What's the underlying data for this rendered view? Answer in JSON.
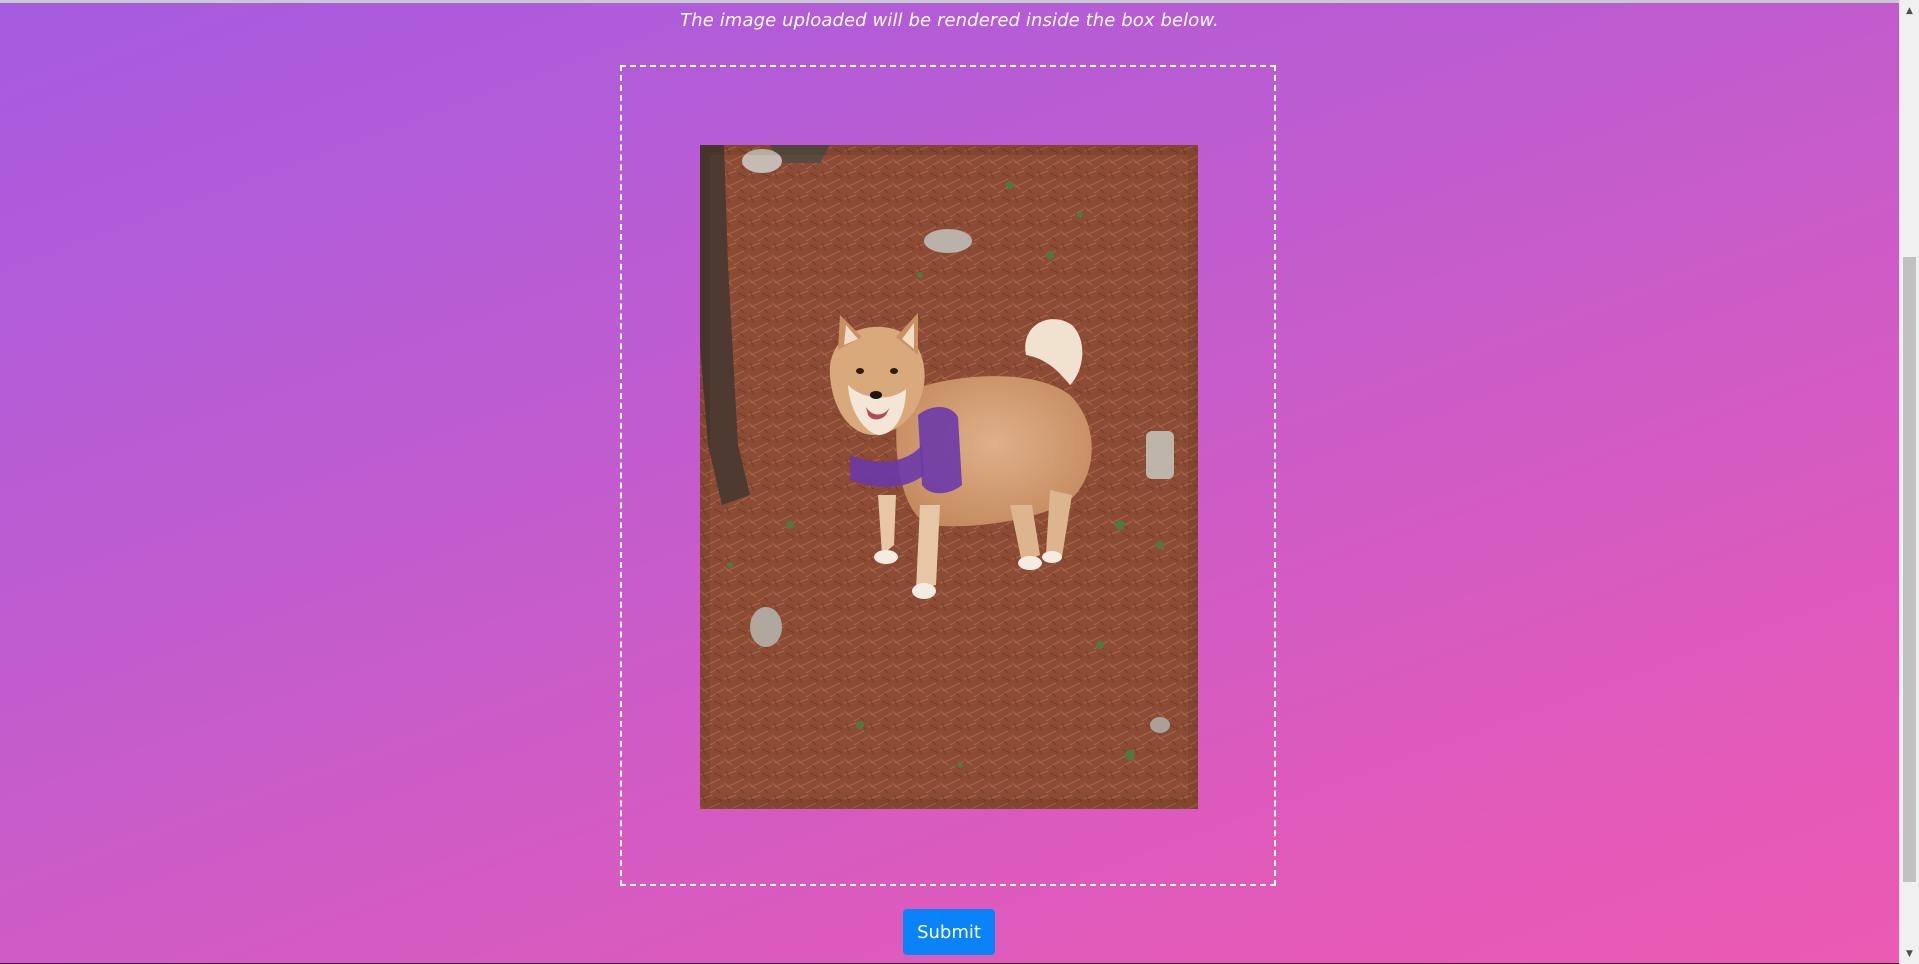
{
  "page": {
    "caption": "The image uploaded will be rendered inside the box below."
  },
  "preview": {
    "image_alt": "Uploaded photo preview: a shiba inu dog with a purple harness standing on reddish-brown pine needles"
  },
  "actions": {
    "submit_label": "Submit"
  },
  "colors": {
    "gradient_start": "#a65be0",
    "gradient_end": "#ec5ab3",
    "button": "#0a82f8",
    "dashed_border": "#ffffff"
  },
  "scrollbar": {
    "up_icon": "chevron-up-icon",
    "down_icon": "chevron-down-icon"
  }
}
